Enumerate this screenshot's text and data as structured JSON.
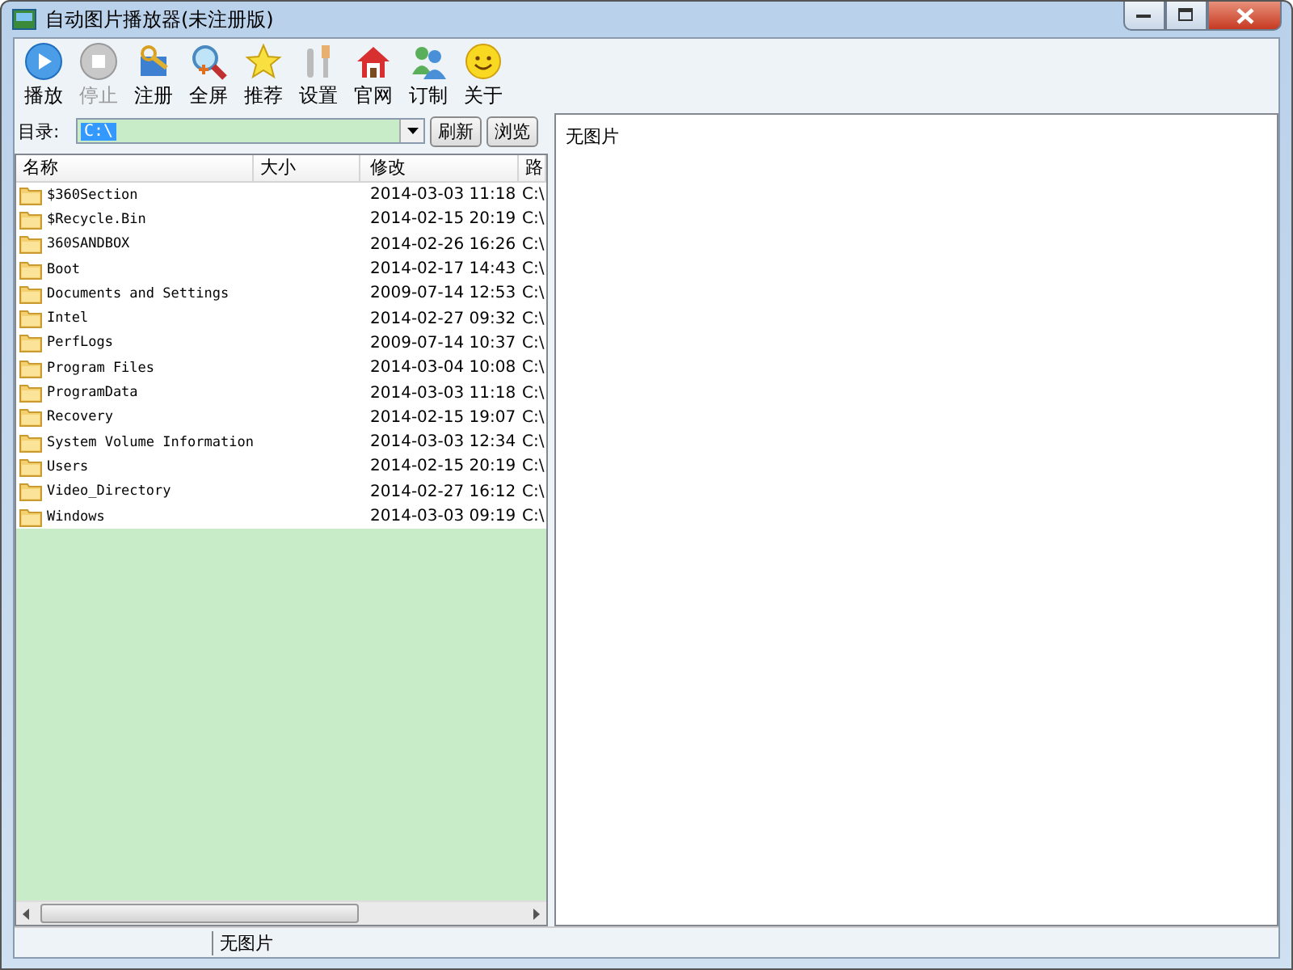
{
  "window": {
    "title": "自动图片播放器(未注册版)"
  },
  "toolbar": [
    {
      "label": "播放",
      "disabled": false
    },
    {
      "label": "停止",
      "disabled": true
    },
    {
      "label": "注册",
      "disabled": false
    },
    {
      "label": "全屏",
      "disabled": false
    },
    {
      "label": "推荐",
      "disabled": false
    },
    {
      "label": "设置",
      "disabled": false
    },
    {
      "label": "官网",
      "disabled": false
    },
    {
      "label": "订制",
      "disabled": false
    },
    {
      "label": "关于",
      "disabled": false
    }
  ],
  "directory": {
    "label": "目录:",
    "value": "C:\\",
    "refresh": "刷新",
    "browse": "浏览"
  },
  "table": {
    "columns": [
      "名称",
      "大小",
      "修改",
      "路"
    ],
    "rows": [
      {
        "name": "$360Section",
        "modified": "2014-03-03 11:18",
        "path": "C:\\"
      },
      {
        "name": "$Recycle.Bin",
        "modified": "2014-02-15 20:19",
        "path": "C:\\"
      },
      {
        "name": "360SANDBOX",
        "modified": "2014-02-26 16:26",
        "path": "C:\\"
      },
      {
        "name": "Boot",
        "modified": "2014-02-17 14:43",
        "path": "C:\\"
      },
      {
        "name": "Documents and Settings",
        "modified": "2009-07-14 12:53",
        "path": "C:\\"
      },
      {
        "name": "Intel",
        "modified": "2014-02-27 09:32",
        "path": "C:\\"
      },
      {
        "name": "PerfLogs",
        "modified": "2009-07-14 10:37",
        "path": "C:\\"
      },
      {
        "name": "Program Files",
        "modified": "2014-03-04 10:08",
        "path": "C:\\"
      },
      {
        "name": "ProgramData",
        "modified": "2014-03-03 11:18",
        "path": "C:\\"
      },
      {
        "name": "Recovery",
        "modified": "2014-02-15 19:07",
        "path": "C:\\"
      },
      {
        "name": "System Volume Information",
        "modified": "2014-03-03 12:34",
        "path": "C:\\"
      },
      {
        "name": "Users",
        "modified": "2014-02-15 20:19",
        "path": "C:\\"
      },
      {
        "name": "Video_Directory",
        "modified": "2014-02-27 16:12",
        "path": "C:\\"
      },
      {
        "name": "Windows",
        "modified": "2014-03-03 09:19",
        "path": "C:\\"
      }
    ]
  },
  "preview": {
    "message": "无图片"
  },
  "status_bar": {
    "text": "无图片"
  }
}
